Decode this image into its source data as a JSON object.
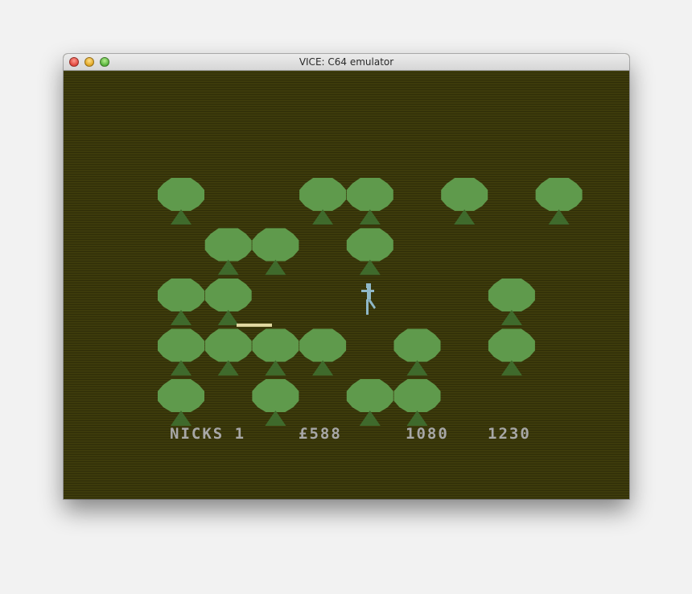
{
  "window": {
    "title": "VICE: C64 emulator",
    "controls": [
      "close",
      "minimize",
      "zoom"
    ]
  },
  "game": {
    "background_color": "#3d3b0b",
    "tree_color": "#5f9a4c",
    "trunk_color": "#3f6a2c",
    "player_color": "#8fb8c8",
    "stick_color": "#e0d8a0",
    "hud": {
      "label": "NICKS 1",
      "money": "£588",
      "score": "1080",
      "high": "1230"
    },
    "tree_grid_rows": [
      "X..XX.X.X",
      ".XX.X....",
      "XX.....X.",
      "XXXX.X.X.",
      "X.X.XX..."
    ]
  }
}
